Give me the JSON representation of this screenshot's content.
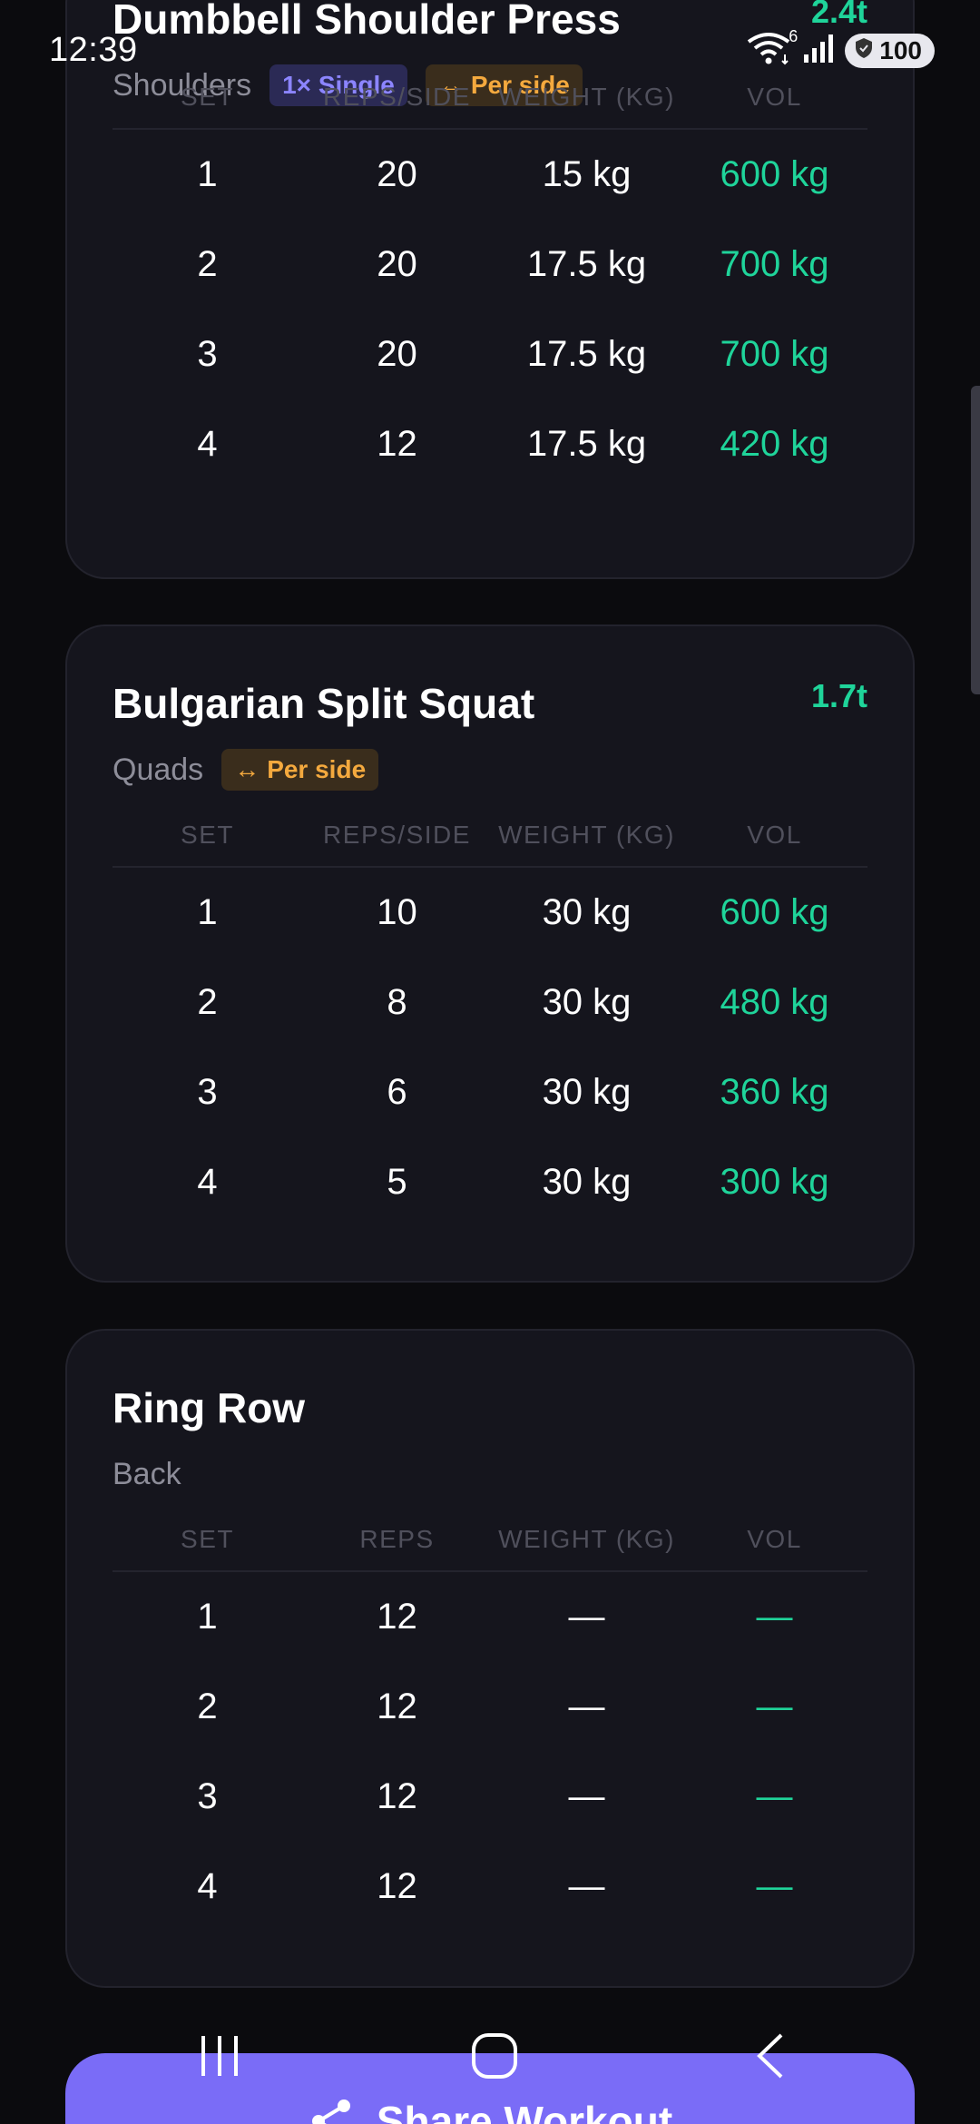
{
  "status": {
    "time": "12:39",
    "battery": "100",
    "network": "6"
  },
  "exercises": [
    {
      "name": "Dumbbell Shoulder Press",
      "volume": "2.4t",
      "muscle": "Shoulders",
      "badges": [
        {
          "label": "1× Single",
          "type": "single",
          "icon": "×"
        },
        {
          "label": "Per side",
          "type": "side",
          "icon": "↔"
        }
      ],
      "headers": [
        "SET",
        "REPS/SIDE",
        "WEIGHT (KG)",
        "VOL"
      ],
      "sets": [
        {
          "set": "1",
          "reps": "20",
          "weight": "15 kg",
          "vol": "600 kg"
        },
        {
          "set": "2",
          "reps": "20",
          "weight": "17.5 kg",
          "vol": "700 kg"
        },
        {
          "set": "3",
          "reps": "20",
          "weight": "17.5 kg",
          "vol": "700 kg"
        },
        {
          "set": "4",
          "reps": "12",
          "weight": "17.5 kg",
          "vol": "420 kg"
        }
      ]
    },
    {
      "name": "Bulgarian Split Squat",
      "volume": "1.7t",
      "muscle": "Quads",
      "badges": [
        {
          "label": "Per side",
          "type": "side",
          "icon": "↔"
        }
      ],
      "headers": [
        "SET",
        "REPS/SIDE",
        "WEIGHT (KG)",
        "VOL"
      ],
      "sets": [
        {
          "set": "1",
          "reps": "10",
          "weight": "30 kg",
          "vol": "600 kg"
        },
        {
          "set": "2",
          "reps": "8",
          "weight": "30 kg",
          "vol": "480 kg"
        },
        {
          "set": "3",
          "reps": "6",
          "weight": "30 kg",
          "vol": "360 kg"
        },
        {
          "set": "4",
          "reps": "5",
          "weight": "30 kg",
          "vol": "300 kg"
        }
      ]
    },
    {
      "name": "Ring Row",
      "volume": "",
      "muscle": "Back",
      "badges": [],
      "headers": [
        "SET",
        "REPS",
        "WEIGHT (KG)",
        "VOL"
      ],
      "sets": [
        {
          "set": "1",
          "reps": "12",
          "weight": "—",
          "vol": "—"
        },
        {
          "set": "2",
          "reps": "12",
          "weight": "—",
          "vol": "—"
        },
        {
          "set": "3",
          "reps": "12",
          "weight": "—",
          "vol": "—"
        },
        {
          "set": "4",
          "reps": "12",
          "weight": "—",
          "vol": "—"
        }
      ]
    }
  ],
  "share": {
    "label": "Share Workout",
    "icon": "share-icon"
  },
  "colors": {
    "accent": "#7a6cf7",
    "volume": "#1fd49a",
    "per_side": "#f4a93e",
    "single": "#8c85ff"
  }
}
